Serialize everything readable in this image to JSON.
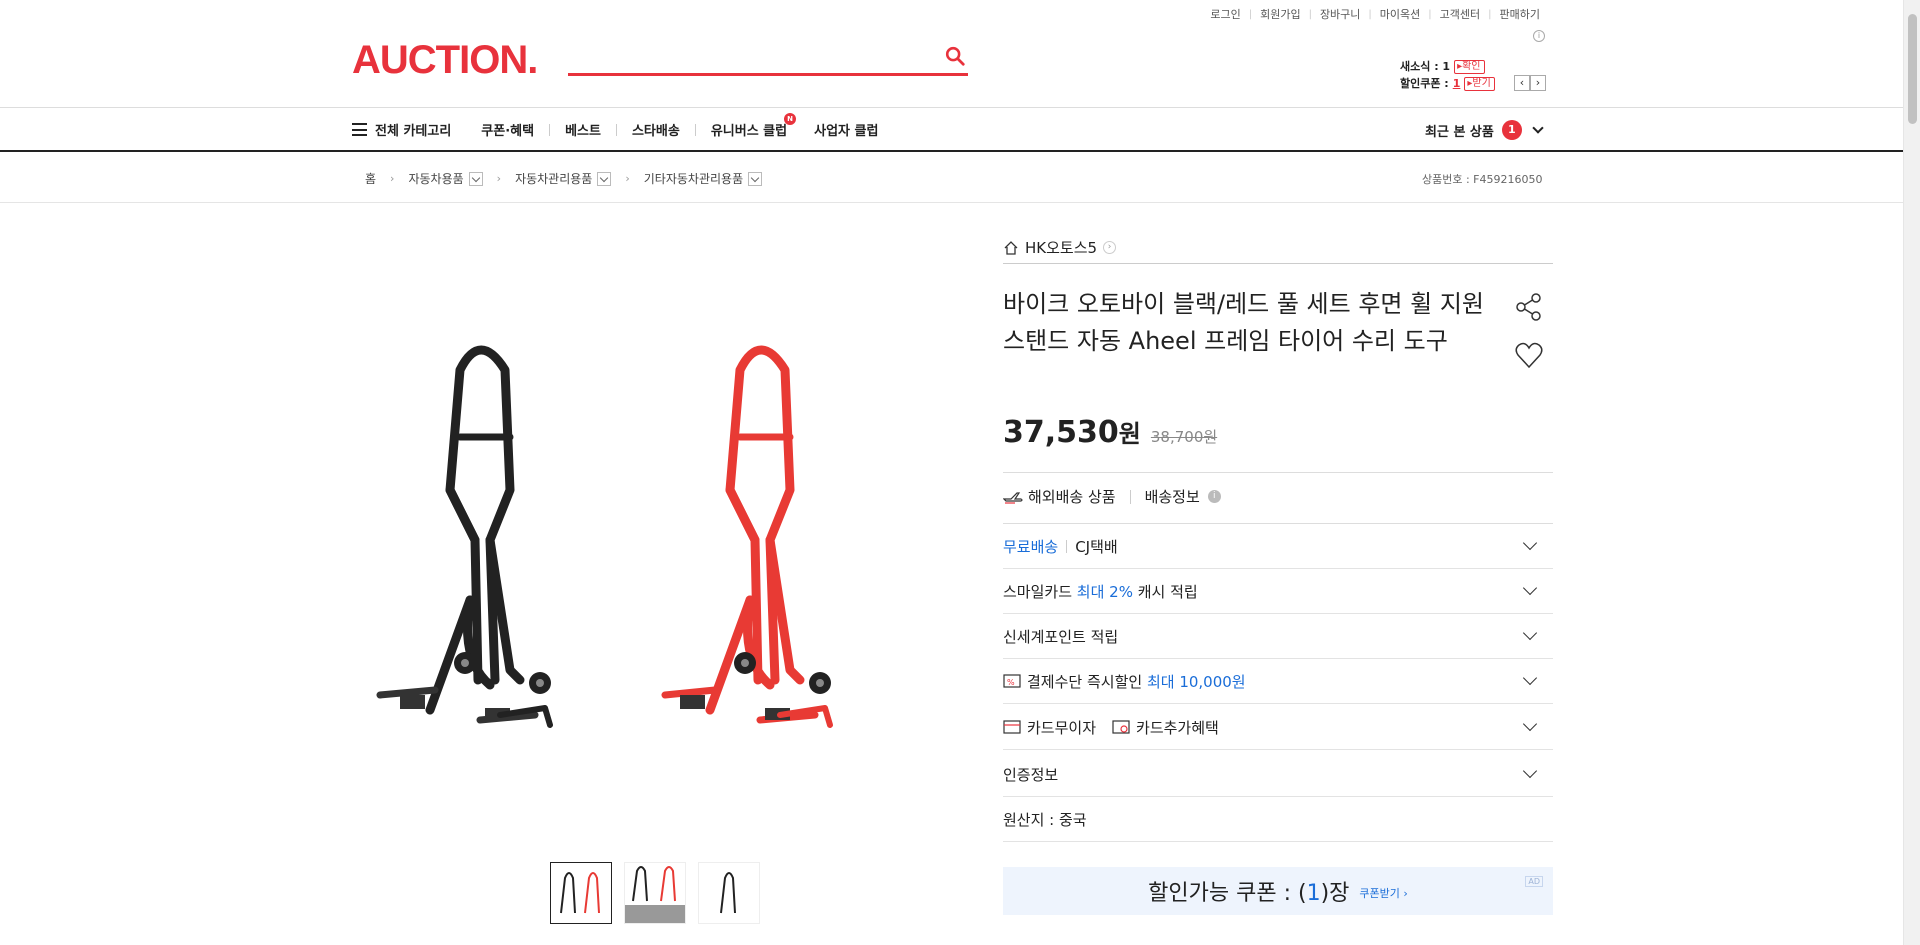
{
  "header": {
    "util_links": [
      "로그인",
      "회원가입",
      "장바구니",
      "마이옥션",
      "고객센터",
      "판매하기"
    ],
    "logo": "AUCTION.",
    "search_placeholder": "",
    "news_label": "새소식 : 1",
    "news_btn": "확인",
    "coupon_label": "할인쿠폰 :",
    "coupon_count": "1",
    "coupon_btn": "받기",
    "prev": "‹",
    "next": "›"
  },
  "nav": {
    "all_category": "전체 카테고리",
    "links": [
      "쿠폰·혜택",
      "베스트",
      "스타배송",
      "유니버스 클럽",
      "사업자 클럽"
    ],
    "new_badge": "N",
    "recent_label": "최근 본 상품",
    "recent_count": "1"
  },
  "breadcrumb": {
    "home": "홈",
    "items": [
      "자동차용품",
      "자동차관리용품",
      "기타자동차관리용품"
    ],
    "product_id": "상품번호 : F459216050"
  },
  "product": {
    "seller": "HK오토스5",
    "title": "바이크 오토바이 블랙/레드 풀 세트 후면 휠 지원 스탠드 자동 Aheel 프레임 타이어 수리 도구",
    "price": "37,530",
    "price_unit": "원",
    "original_price": "38,700원",
    "overseas": "해외배송 상품",
    "shipping_info": "배송정보",
    "accordion": {
      "free_ship": "무료배송",
      "carrier": "CJ택배",
      "smile_prefix": "스마일카드",
      "smile_highlight": "최대 2%",
      "smile_suffix": "캐시 적립",
      "shinsegae": "신세계포인트 적립",
      "pay_prefix": "결제수단 즉시할인",
      "pay_highlight": "최대 10,000원",
      "card_free": "카드무이자",
      "card_extra": "카드추가혜택",
      "cert": "인증정보",
      "origin": "원산지 : 중국"
    },
    "coupon": {
      "prefix": "할인가능 쿠폰 : (",
      "count": "1",
      "suffix": ")장",
      "get": "쿠폰받기 ›",
      "ad": "AD"
    }
  },
  "colors": {
    "brand": "#e8323c",
    "link_blue": "#1a6dd8"
  }
}
